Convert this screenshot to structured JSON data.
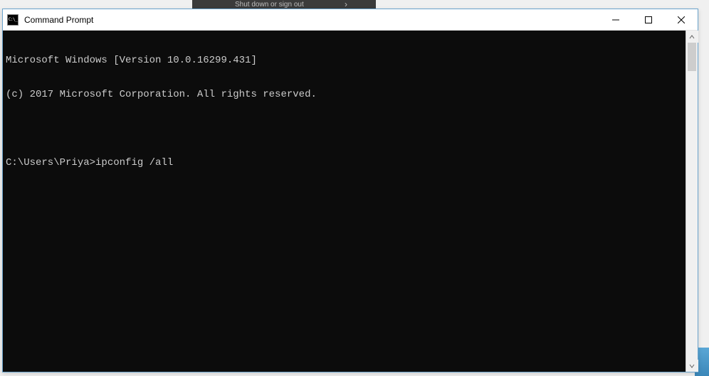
{
  "background": {
    "menu_item": "Shut down or sign out"
  },
  "window": {
    "title": "Command Prompt"
  },
  "terminal": {
    "line1": "Microsoft Windows [Version 10.0.16299.431]",
    "line2": "(c) 2017 Microsoft Corporation. All rights reserved.",
    "blank": "",
    "prompt": "C:\\Users\\Priya>",
    "command": "ipconfig /all"
  }
}
